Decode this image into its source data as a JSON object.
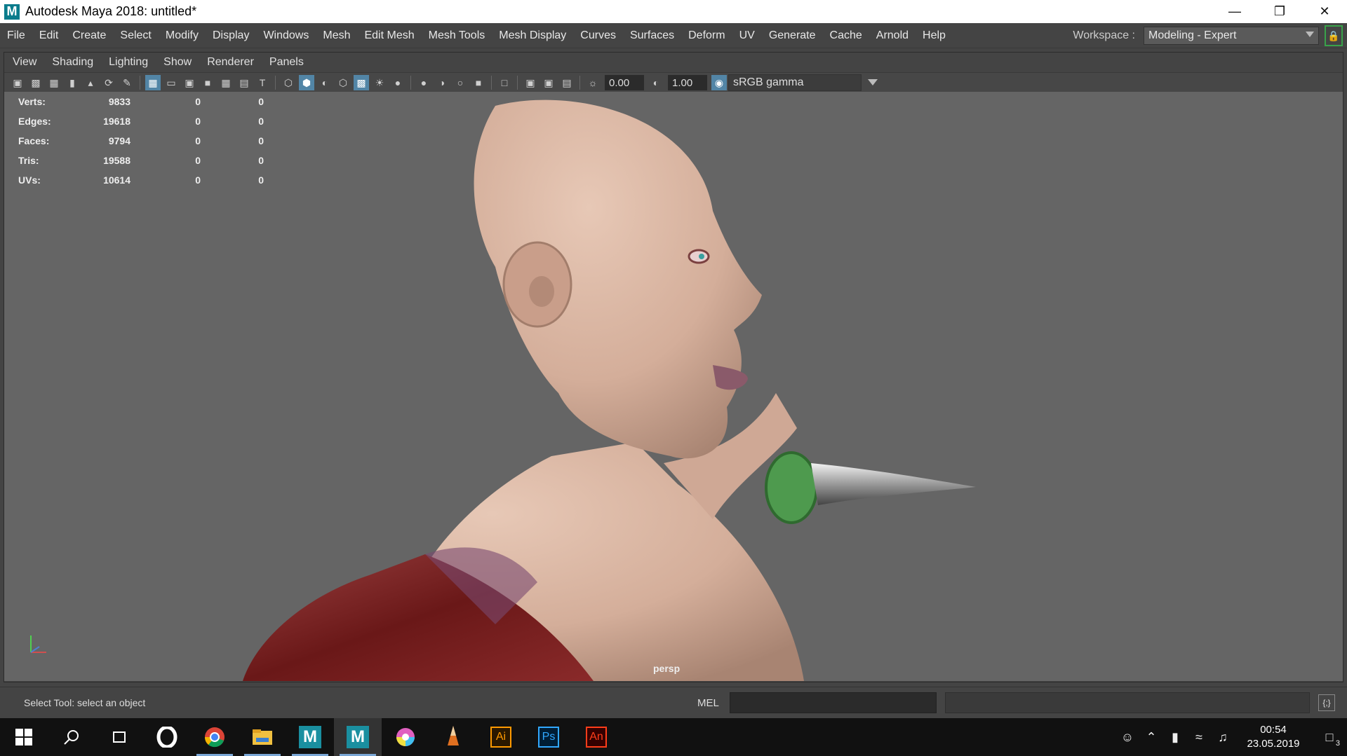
{
  "window": {
    "title": "Autodesk Maya 2018: untitled*",
    "logo_letter": "M",
    "controls": [
      "minimize",
      "restore",
      "close"
    ]
  },
  "menubar": {
    "items": [
      "File",
      "Edit",
      "Create",
      "Select",
      "Modify",
      "Display",
      "Windows",
      "Mesh",
      "Edit Mesh",
      "Mesh Tools",
      "Mesh Display",
      "Curves",
      "Surfaces",
      "Deform",
      "UV",
      "Generate",
      "Cache",
      "Arnold",
      "Help"
    ],
    "workspace_label": "Workspace :",
    "workspace_value": "Modeling - Expert"
  },
  "panel": {
    "menu": [
      "View",
      "Shading",
      "Lighting",
      "Show",
      "Renderer",
      "Panels"
    ],
    "toolbar": {
      "exposure": "0.00",
      "gamma": "1.00",
      "color_space": "sRGB gamma"
    }
  },
  "hud": {
    "rows": [
      {
        "label": "Verts:",
        "v1": "9833",
        "v2": "0",
        "v3": "0"
      },
      {
        "label": "Edges:",
        "v1": "19618",
        "v2": "0",
        "v3": "0"
      },
      {
        "label": "Faces:",
        "v1": "9794",
        "v2": "0",
        "v3": "0"
      },
      {
        "label": "Tris:",
        "v1": "19588",
        "v2": "0",
        "v3": "0"
      },
      {
        "label": "UVs:",
        "v1": "10614",
        "v2": "0",
        "v3": "0"
      }
    ],
    "camera": "persp"
  },
  "statusline": {
    "help": "Select Tool: select an object",
    "command_label": "MEL"
  },
  "taskbar": {
    "apps": [
      "start",
      "search",
      "task-view",
      "opera",
      "chrome",
      "explorer",
      "maya",
      "maya",
      "color-app",
      "pencil-app",
      "illustrator",
      "photoshop",
      "animate"
    ],
    "app_labels": {
      "illustrator": "Ai",
      "photoshop": "Ps",
      "animate": "An",
      "maya": "M"
    },
    "time": "00:54",
    "date": "23.05.2019",
    "notification_count": "3"
  },
  "colors": {
    "viewport_bg": "#656565",
    "skin": "#d8b6a4",
    "cloth": "#7a2020",
    "wrap": "#4a8a4a",
    "highlight": "#5285a6"
  }
}
